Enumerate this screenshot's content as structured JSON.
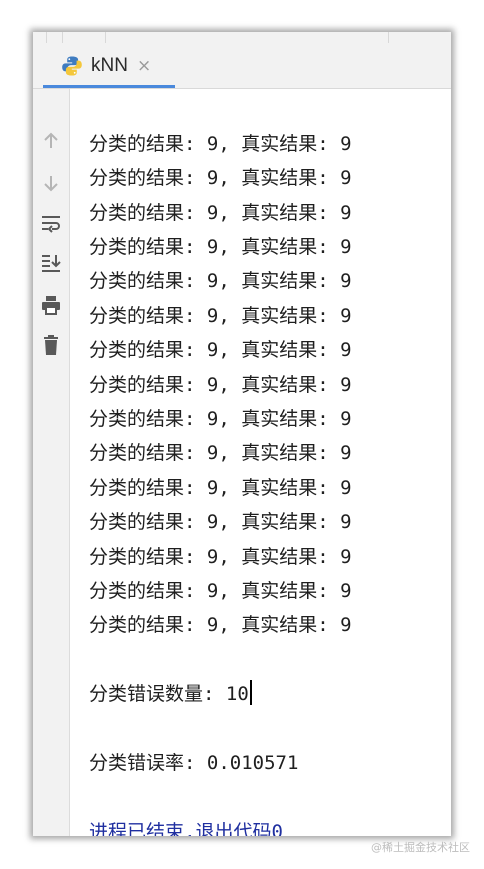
{
  "tab": {
    "label": "kNN",
    "icon": "python-icon",
    "close": "×"
  },
  "toolbar": {
    "icons": [
      "arrow-up-icon",
      "arrow-down-icon",
      "soft-wrap-icon",
      "scroll-to-end-icon",
      "print-icon",
      "trash-icon"
    ]
  },
  "console": {
    "result_lines": [
      "分类的结果: 9, 真实结果: 9",
      "分类的结果: 9, 真实结果: 9",
      "分类的结果: 9, 真实结果: 9",
      "分类的结果: 9, 真实结果: 9",
      "分类的结果: 9, 真实结果: 9",
      "分类的结果: 9, 真实结果: 9",
      "分类的结果: 9, 真实结果: 9",
      "分类的结果: 9, 真实结果: 9",
      "分类的结果: 9, 真实结果: 9",
      "分类的结果: 9, 真实结果: 9",
      "分类的结果: 9, 真实结果: 9",
      "分类的结果: 9, 真实结果: 9",
      "分类的结果: 9, 真实结果: 9",
      "分类的结果: 9, 真实结果: 9",
      "分类的结果: 9, 真实结果: 9"
    ],
    "error_count": "分类错误数量: 10",
    "error_rate": "分类错误率: 0.010571",
    "exit_message": "进程已结束,退出代码0"
  },
  "watermark": "@稀土掘金技术社区",
  "colors": {
    "tab_underline": "#4a89dc",
    "exit_text": "#1f2fa0",
    "panel_bg": "#f2f2f2"
  }
}
